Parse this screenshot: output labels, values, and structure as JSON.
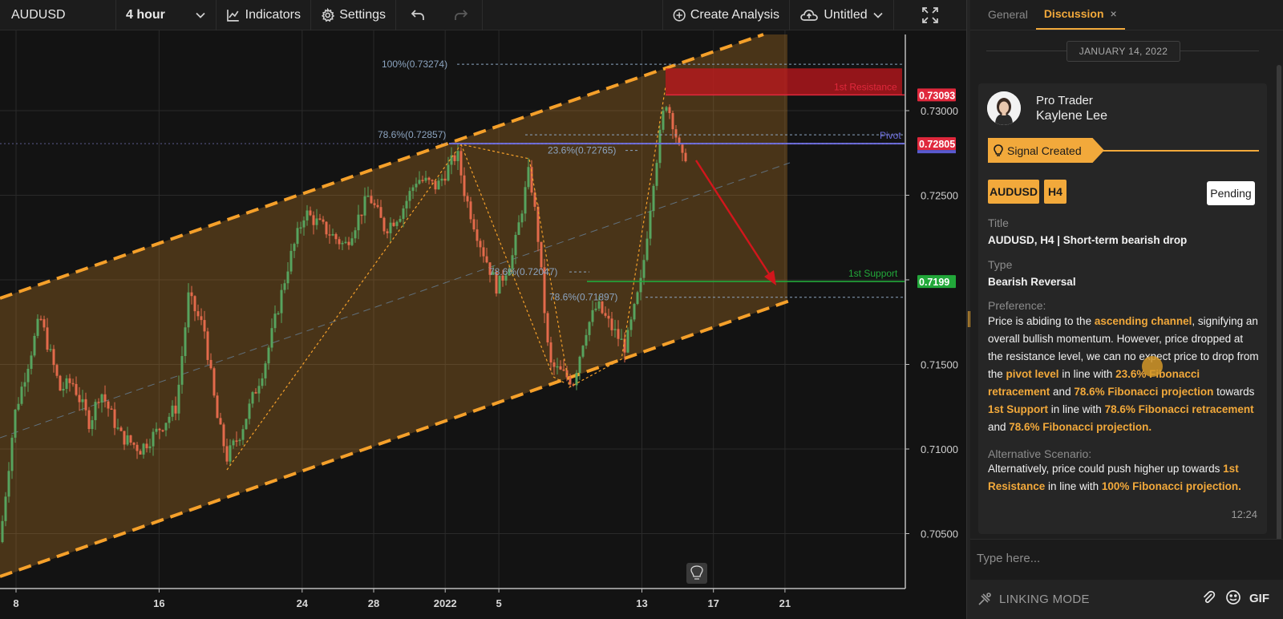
{
  "toolbar": {
    "symbol": "AUDUSD",
    "interval": "4 hour",
    "indicators_label": "Indicators",
    "settings_label": "Settings",
    "create_analysis_label": "Create Analysis",
    "layout_name": "Untitled"
  },
  "chart": {
    "price_labels": [
      {
        "price": 0.73,
        "text": "0.73000"
      },
      {
        "price": 0.725,
        "text": "0.72500"
      },
      {
        "price": 0.72,
        "text": "0.7200"
      },
      {
        "price": 0.715,
        "text": "0.71500"
      },
      {
        "price": 0.71,
        "text": "0.71000"
      },
      {
        "price": 0.705,
        "text": "0.70500"
      }
    ],
    "time_labels": [
      {
        "text": "8",
        "x": 0
      },
      {
        "text": "16",
        "x": 8
      },
      {
        "text": "24",
        "x": 16
      },
      {
        "text": "28",
        "x": 20
      },
      {
        "text": "2022",
        "x": 24
      },
      {
        "text": "5",
        "x": 27
      },
      {
        "text": "13",
        "x": 35
      },
      {
        "text": "17",
        "x": 39
      },
      {
        "text": "21",
        "x": 43
      }
    ],
    "badges": [
      {
        "price": 0.73093,
        "text": "0.73093",
        "color": "#e0283c"
      },
      {
        "price": 0.72805,
        "text": "0.72805",
        "color": "#e0283c"
      },
      {
        "price": 0.7199,
        "text": "0.7199",
        "color": "#22a83a"
      }
    ],
    "levels": {
      "resistance": {
        "price": 0.73093,
        "label": "1st Resistance",
        "color": "#e0283c"
      },
      "pivot": {
        "price": 0.72805,
        "label": "Pivot",
        "color": "#6d6de0"
      },
      "support": {
        "price": 0.7199,
        "label": "1st Support",
        "color": "#22a83a"
      }
    },
    "fib_labels": [
      {
        "text": "100%(0.73274)",
        "price": 0.73274
      },
      {
        "text": "78.6%(0.72857)",
        "price": 0.72857
      },
      {
        "text": "23.6%(0.72765)",
        "price": 0.72765
      },
      {
        "text": "78.6%(0.72047)",
        "price": 0.72047
      },
      {
        "text": "78.6%(0.71897)",
        "price": 0.71897
      }
    ],
    "colors": {
      "up": "#57a35e",
      "down": "#e36a4b",
      "channel": "#f5a02a",
      "fib": "#8ca4c0"
    }
  },
  "panel": {
    "tab_general": "General",
    "tab_discussion": "Discussion",
    "tab_close": "×",
    "date": "JANUARY 14, 2022",
    "author_role": "Pro Trader",
    "author_name": "Kaylene Lee",
    "signal_label": "Signal Created",
    "tag_symbol": "AUDUSD",
    "tag_interval": "H4",
    "status": "Pending",
    "title_label": "Title",
    "title_value": "AUDUSD, H4 | Short-term bearish drop",
    "type_label": "Type",
    "type_value": "Bearish Reversal",
    "preference_label": "Preference:",
    "preference": {
      "t1": "Price is abiding to the ",
      "h1": "ascending channel",
      "t2": ", signifying an overall bullish momentum. However, price dropped at the resistance level, we can no expect price to drop from the ",
      "h2": "pivot level",
      "t3": " in line  with ",
      "h3": "23.6% Fibonacci retracement",
      "t4": " and ",
      "h4": "78.6% Fibonacci projection",
      "t5": " towards ",
      "h5": "1st Support",
      "t6": " in line with ",
      "h6": "78.6% Fibonacci retracement",
      "t7": " and ",
      "h7": "78.6% Fibonacci projection."
    },
    "alternative_label": "Alternative Scenario:",
    "alternative": {
      "t1": "Alternatively, price could push higher up towards ",
      "h1": "1st Resistance",
      "t2": " in line with ",
      "h2": "100% Fibonacci projection."
    },
    "time": "12:24",
    "input_placeholder": "Type here...",
    "linking_mode": "LINKING MODE",
    "gif_label": "GIF"
  }
}
